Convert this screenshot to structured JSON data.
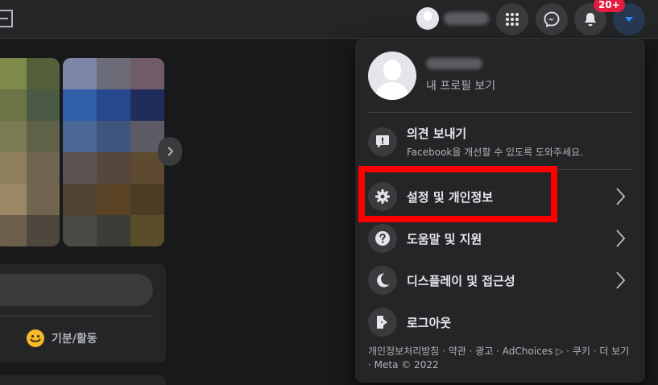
{
  "topbar": {
    "notification_count": "20+",
    "icons": [
      "menu-grid-icon",
      "messenger-icon",
      "bell-icon",
      "account-caret-icon"
    ]
  },
  "left": {
    "feeling_label": "기분/활동"
  },
  "menu": {
    "profile": {
      "link_label": "내 프로필 보기"
    },
    "feedback": {
      "title": "의견 보내기",
      "subtitle": "Facebook을 개선할 수 있도록 도와주세요."
    },
    "items": [
      {
        "label": "설정 및 개인정보",
        "icon": "gear-icon",
        "has_chevron": true
      },
      {
        "label": "도움말 및 지원",
        "icon": "question-icon",
        "has_chevron": true
      },
      {
        "label": "디스플레이 및 접근성",
        "icon": "moon-icon",
        "has_chevron": true
      },
      {
        "label": "로그아웃",
        "icon": "logout-icon",
        "has_chevron": false
      }
    ],
    "footer": "개인정보처리방침 · 약관 · 광고 · AdChoices ▷ · 쿠키 · 더 보기 · Meta © 2022"
  },
  "colors": {
    "background": "#18191a",
    "surface": "#242526",
    "highlight": "#ff0000",
    "accent": "#2d88ff",
    "badge": "#e41e3f"
  }
}
